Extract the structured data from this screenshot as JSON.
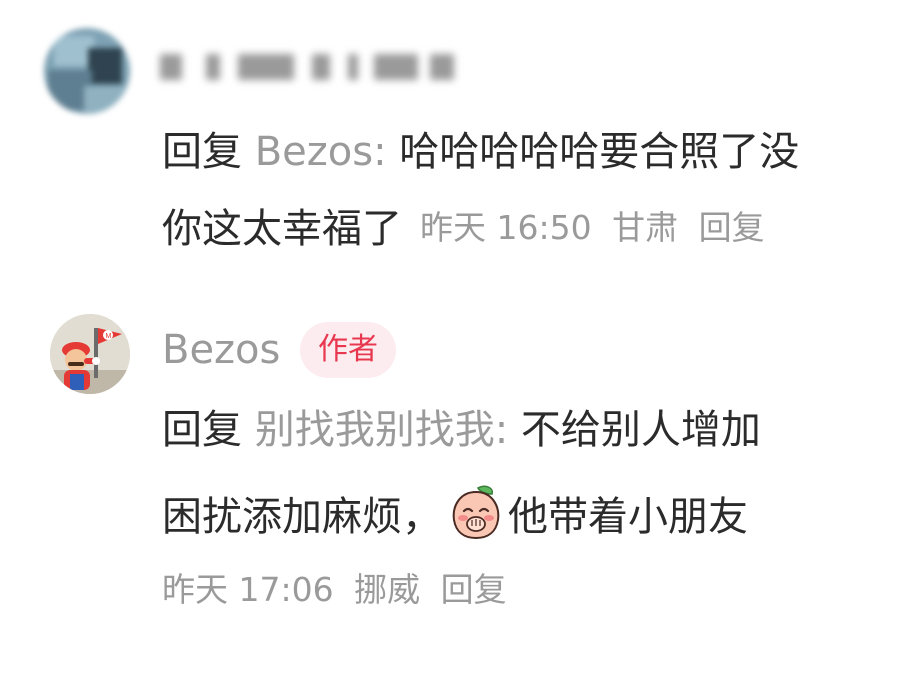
{
  "comments": [
    {
      "author": "",
      "reply_prefix": "回复",
      "reply_target": "Bezos:",
      "text_line1": "哈哈哈哈哈要合照了没",
      "text_line2": "你这太幸福了",
      "time": "昨天 16:50",
      "location": "甘肃",
      "reply_label": "回复"
    },
    {
      "author": "Bezos",
      "author_badge": "作者",
      "reply_prefix": "回复",
      "reply_target": "别找我别找我:",
      "text_line1": "不给别人增加",
      "text_line2_before_emoji": "困扰添加麻烦，",
      "emoji": "blushing-peach-emoji",
      "text_line2_after_emoji": "他带着小朋友",
      "time": "昨天 17:06",
      "location": "挪威",
      "reply_label": "回复"
    }
  ],
  "colors": {
    "text": "#2b2b2b",
    "muted": "#9a9a9a",
    "badge_text": "#e8384f",
    "badge_bg": "#fdecef"
  }
}
